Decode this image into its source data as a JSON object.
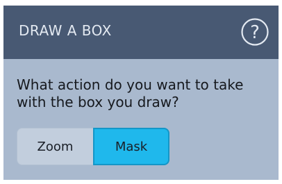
{
  "header": {
    "title": "DRAW A BOX",
    "help_icon": "question-circle-icon",
    "help_glyph": "?"
  },
  "prompt": {
    "text": "What action do you want to take with the box you draw?"
  },
  "toggle": {
    "options": [
      {
        "label": "Zoom",
        "selected": false
      },
      {
        "label": "Mask",
        "selected": true
      }
    ]
  },
  "colors": {
    "header_bg": "#485973",
    "panel_bg": "#a9b9ce",
    "selected_accent": "#1fb8ec",
    "unselected_option": "#c2cedd"
  }
}
